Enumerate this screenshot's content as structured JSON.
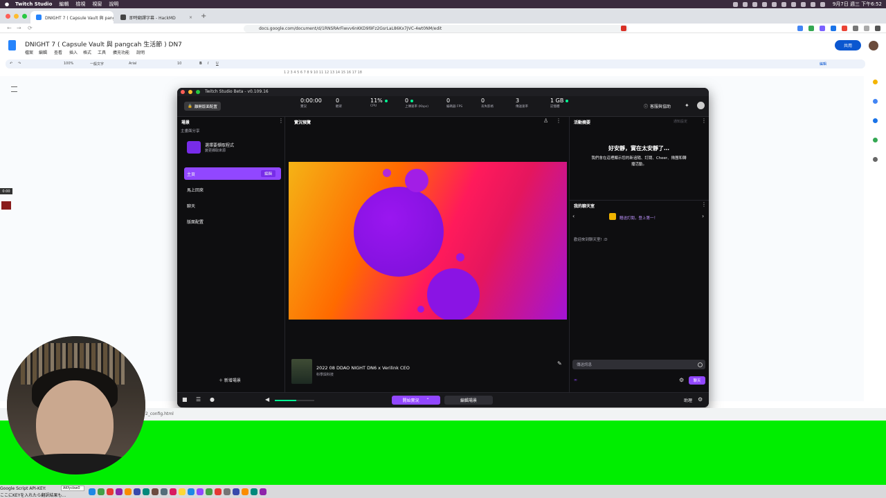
{
  "menubar": {
    "app": "Twitch Studio",
    "items": [
      "編輯",
      "檢視",
      "視窗",
      "說明"
    ],
    "clock": "9月7日 週三 下午6:52"
  },
  "browser": {
    "tabs": [
      {
        "label": "DNIGHT 7 ( Capsule Vault 與 pangcah 生活節 ) DN7",
        "active": true
      },
      {
        "label": "即時翻譯字幕 - HackMD",
        "active": false
      }
    ],
    "new_tab": "+",
    "url": "docs.google.com/document/d/1RNSRArFiwvv6nKKD9l9Fz2GsrLaL86Kx7JVC-4wt0NM/edit",
    "nav_back": "←",
    "nav_forward": "→",
    "nav_reload": "⟳"
  },
  "docs": {
    "title": "DNIGHT 7 ( Capsule Vault 與 pangcah 生活節 ) DN7",
    "menus": [
      "檔案",
      "編輯",
      "查看",
      "插入",
      "格式",
      "工具",
      "擴充功能",
      "說明"
    ],
    "share": "共用",
    "toolbar": {
      "zoom": "100%",
      "style": "一般文字",
      "font": "Arial",
      "size": "10",
      "mode": "編輯"
    },
    "ruler": "1   2   3   4   5   6   7   8   9   10   11   12   13   14   15   16   17   18"
  },
  "twitch": {
    "window_title": "Twitch Studio Beta - v0.109.16",
    "layout_button": "離開版面配置",
    "stats": [
      {
        "value": "0:00:00",
        "label": "實況",
        "status": ""
      },
      {
        "value": "0",
        "label": "觀眾",
        "status": ""
      },
      {
        "value": "11%",
        "label": "CPU",
        "status": "ok"
      },
      {
        "value": "0",
        "label": "上傳速率 (Kbps)",
        "status": "ok"
      },
      {
        "value": "0",
        "label": "編碼器 FPS",
        "status": ""
      },
      {
        "value": "0",
        "label": "丟失影格",
        "status": ""
      },
      {
        "value": "3",
        "label": "傳送速率",
        "status": ""
      },
      {
        "value": "1 GB",
        "label": "記憶體",
        "status": "ok"
      }
    ],
    "help": "客服與協助",
    "scenes": {
      "header": "場景",
      "shared_label": "主畫面分享",
      "share_app_title": "選擇要擷取程式",
      "share_app_sub": "變更擷取來源",
      "items": [
        {
          "label": "主頁",
          "active": true,
          "edit": "編輯"
        },
        {
          "label": "馬上回來",
          "active": false
        },
        {
          "label": "聊天",
          "active": false
        },
        {
          "label": "版面配置",
          "active": false
        }
      ],
      "add_scene": "新增場景"
    },
    "preview": {
      "header": "實況預覽",
      "stream_title": "2022 08 DDAO NIGHT DN6 x Verilink CEO",
      "stream_category": "科學與科技"
    },
    "activity": {
      "header": "活動摘要",
      "settings": "通知設定",
      "quiet_title": "好安靜，實在太安靜了…",
      "quiet_desc": "我們會在這裡顯示您的新追隨、訂閱、Cheer、揪團和轉播活動。"
    },
    "chat": {
      "header": "我的聊天室",
      "banner": "贈送訂閱，登上第一！",
      "welcome": "歡迎來到聊天室! :D",
      "placeholder": "傳送訊息",
      "points": "∞",
      "send": "聊天"
    },
    "bottom": {
      "volume": 0.55,
      "start": "開始實況",
      "edit_scenes": "編輯場景",
      "help": "助理"
    }
  },
  "downloads": {
    "file": "2_config.html"
  },
  "recorder": {
    "time": "0:00"
  },
  "dock": {
    "caption1": "Google Script API-KEY:",
    "badge": "AKfycbw0",
    "caption2": "ここにKEYを入れたら翻訳結果も…"
  }
}
